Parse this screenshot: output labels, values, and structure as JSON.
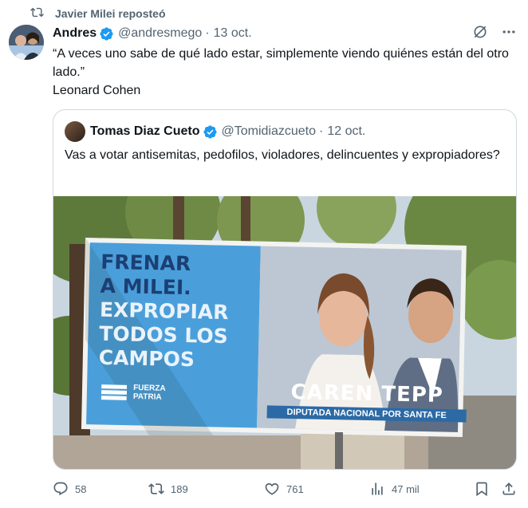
{
  "repost": {
    "label": "Javier Milei reposteó"
  },
  "tweet": {
    "author_name": "Andres",
    "handle": "@andresmego",
    "separator": "·",
    "date": "13 oct.",
    "text_line1": "“A veces uno sabe de qué lado estar, simplemente viendo quiénes están del otro lado.”",
    "text_line2": "Leonard Cohen"
  },
  "quote": {
    "author_name": "Tomas Diaz Cueto",
    "handle": "@Tomidiazcueto",
    "separator": "·",
    "date": "12 oct.",
    "text": "Vas a votar antisemitas, pedofilos, violadores, delincuentes y expropiadores?"
  },
  "billboard": {
    "slogan_line1": "FRENAR",
    "slogan_line2": "A MILEI.",
    "slogan_line3": "EXPROPIAR",
    "slogan_line4": "TODOS LOS",
    "slogan_line5": "CAMPOS",
    "party_line1": "FUERZA",
    "party_line2": "PATRIA",
    "candidate_name": "CAREN TEPP",
    "candidate_role": "DIPUTADA NACIONAL POR SANTA FE"
  },
  "actions": {
    "replies": "58",
    "reposts": "189",
    "likes": "761",
    "views": "47 mil"
  },
  "colors": {
    "verified": "#1d9bf0",
    "muted": "#536471",
    "text": "#0f1419",
    "border": "#cfd9de",
    "billboard_blue": "#4a9fdb"
  },
  "icons": [
    "repost-icon",
    "verified-badge-icon",
    "grok-icon",
    "more-icon",
    "reply-icon",
    "like-icon",
    "views-icon",
    "bookmark-icon",
    "share-icon"
  ]
}
